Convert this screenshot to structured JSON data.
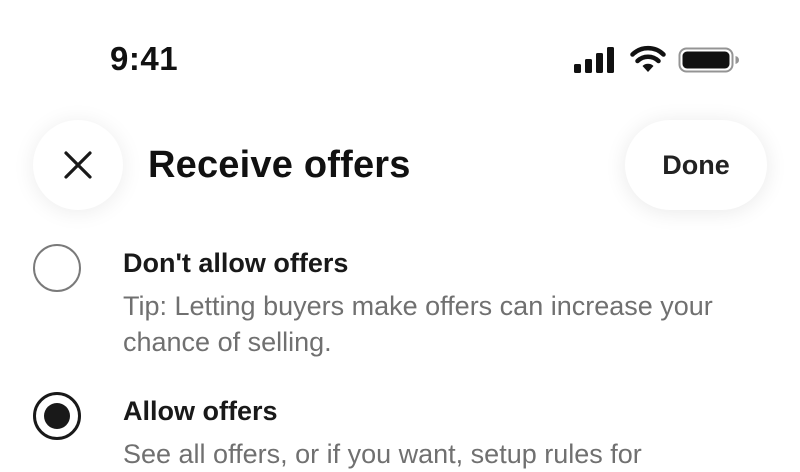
{
  "status_bar": {
    "time": "9:41",
    "icons": [
      "signal-icon",
      "wifi-icon",
      "battery-icon"
    ]
  },
  "header": {
    "close_icon": "close-icon",
    "title": "Receive offers",
    "done_label": "Done"
  },
  "options": [
    {
      "label": "Don't allow offers",
      "description": "Tip: Letting buyers make offers can increase your chance of selling.",
      "selected": false
    },
    {
      "label": "Allow offers",
      "description": "See all offers, or if you want, setup rules for",
      "selected": true
    }
  ],
  "colors": {
    "text_primary": "#191919",
    "text_secondary": "#707070",
    "radio_unselected_border": "#7a7a7a",
    "background": "#ffffff"
  }
}
